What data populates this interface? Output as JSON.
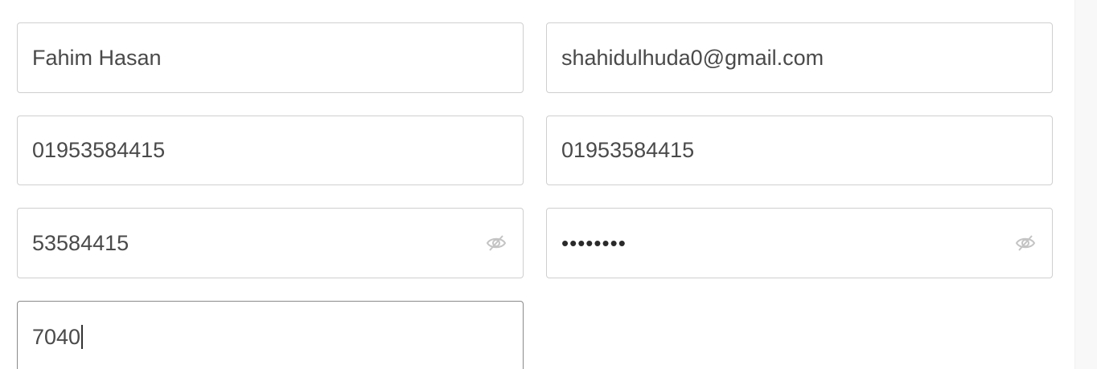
{
  "form": {
    "name": {
      "value": "Fahim Hasan"
    },
    "email": {
      "value": "shahidulhuda0@gmail.com"
    },
    "phone": {
      "value": "01953584415"
    },
    "phone_confirm": {
      "value": "01953584415"
    },
    "password": {
      "value": "53584415",
      "toggle_icon": "eye-slash-icon"
    },
    "password_confirm": {
      "value": "••••••••",
      "toggle_icon": "eye-slash-icon"
    },
    "code": {
      "value": "7040"
    }
  }
}
